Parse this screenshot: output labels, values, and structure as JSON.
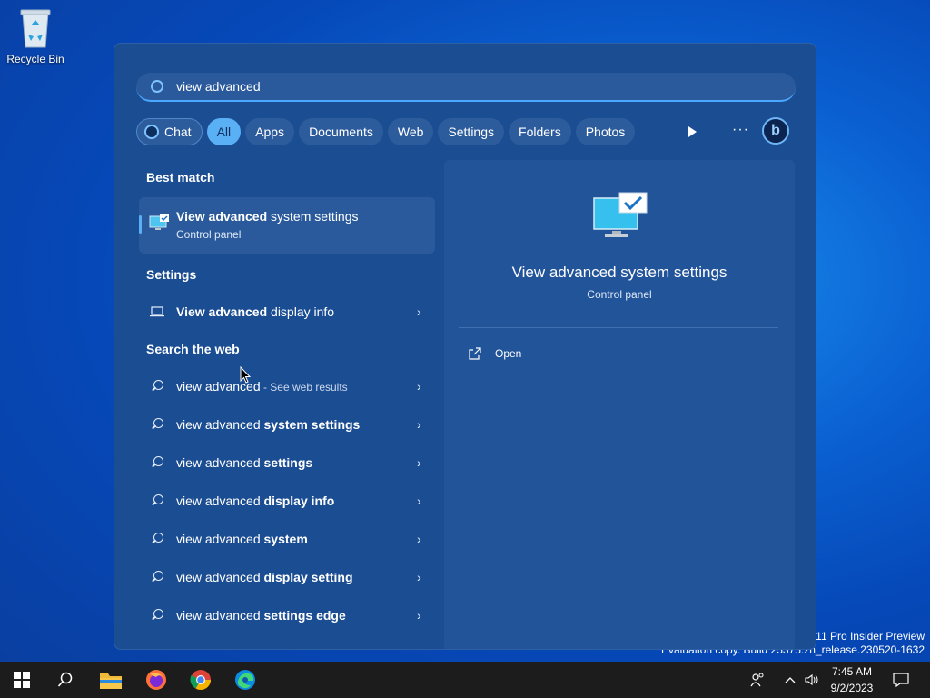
{
  "desktop": {
    "recycle_bin_label": "Recycle Bin",
    "watermark_line1": "s 11 Pro Insider Preview",
    "watermark_line2": "Evaluation copy. Build 25375.zn_release.230520-1632"
  },
  "search": {
    "query": "view advanced"
  },
  "filters": {
    "chat": "Chat",
    "all": "All",
    "apps": "Apps",
    "documents": "Documents",
    "web": "Web",
    "settings": "Settings",
    "folders": "Folders",
    "photos": "Photos",
    "more": "···",
    "bing": "b"
  },
  "sections": {
    "best_match": "Best match",
    "settings": "Settings",
    "search_web": "Search the web"
  },
  "best_match": {
    "title_bold": "View advanced",
    "title_rest": " system settings",
    "subtitle": "Control panel"
  },
  "settings_items": [
    {
      "bold": "View advanced",
      "rest": " display info"
    }
  ],
  "web_results": [
    {
      "prefix": "view advanced",
      "bold": "",
      "suffix": " - See web results"
    },
    {
      "prefix": "view advanced ",
      "bold": "system settings",
      "suffix": ""
    },
    {
      "prefix": "view advanced ",
      "bold": "settings",
      "suffix": ""
    },
    {
      "prefix": "view advanced ",
      "bold": "display info",
      "suffix": ""
    },
    {
      "prefix": "view advanced ",
      "bold": "system",
      "suffix": ""
    },
    {
      "prefix": "view advanced ",
      "bold": "display setting",
      "suffix": ""
    },
    {
      "prefix": "view advanced ",
      "bold": "settings edge",
      "suffix": ""
    }
  ],
  "preview": {
    "title": "View advanced system settings",
    "subtitle": "Control panel",
    "open_label": "Open"
  },
  "taskbar": {
    "time": "7:45 AM",
    "date": "9/2/2023"
  },
  "icons": {
    "start": "windows-logo-icon",
    "search": "search-icon",
    "explorer": "folder-icon",
    "firefox": "firefox-icon",
    "chrome": "chrome-icon",
    "edge": "edge-icon"
  }
}
